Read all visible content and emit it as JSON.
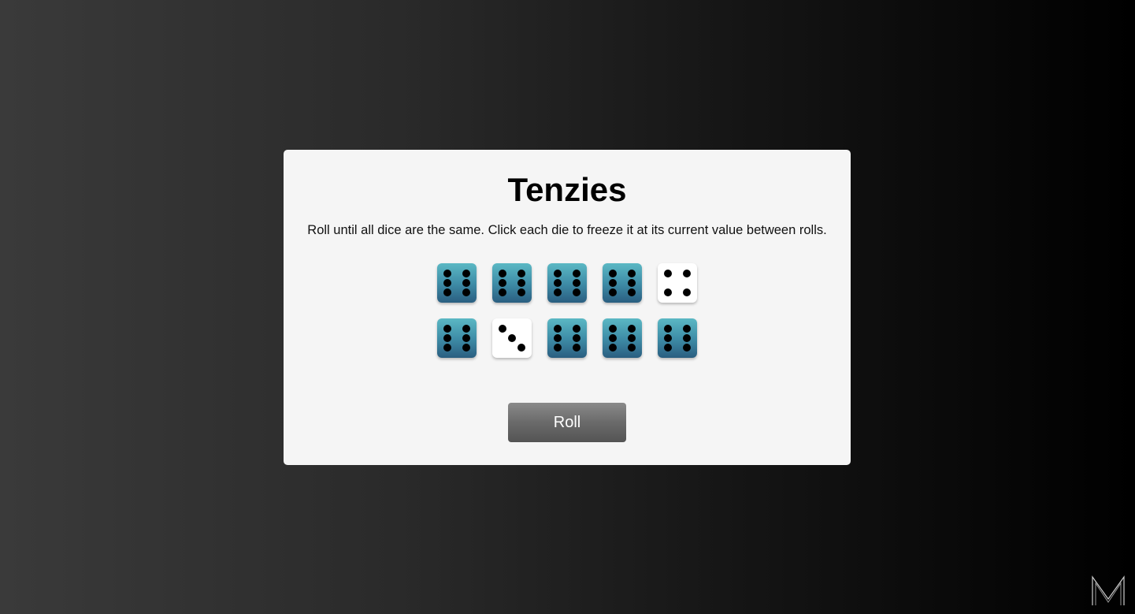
{
  "game": {
    "title": "Tenzies",
    "instructions": "Roll until all dice are the same. Click each die to freeze it at its current value between rolls.",
    "roll_label": "Roll",
    "dice": [
      {
        "value": 6,
        "held": true
      },
      {
        "value": 6,
        "held": true
      },
      {
        "value": 6,
        "held": true
      },
      {
        "value": 6,
        "held": true
      },
      {
        "value": 4,
        "held": false
      },
      {
        "value": 6,
        "held": true
      },
      {
        "value": 3,
        "held": false
      },
      {
        "value": 6,
        "held": true
      },
      {
        "value": 6,
        "held": true
      },
      {
        "value": 6,
        "held": true
      }
    ]
  },
  "colors": {
    "held_die_top": "#5bb8c4",
    "held_die_bottom": "#2a5e80",
    "free_die": "#ffffff",
    "pip": "#000000",
    "board": "#f5f5f5",
    "button": "#6a6a6a"
  },
  "logo_icon": "m-monogram-icon"
}
